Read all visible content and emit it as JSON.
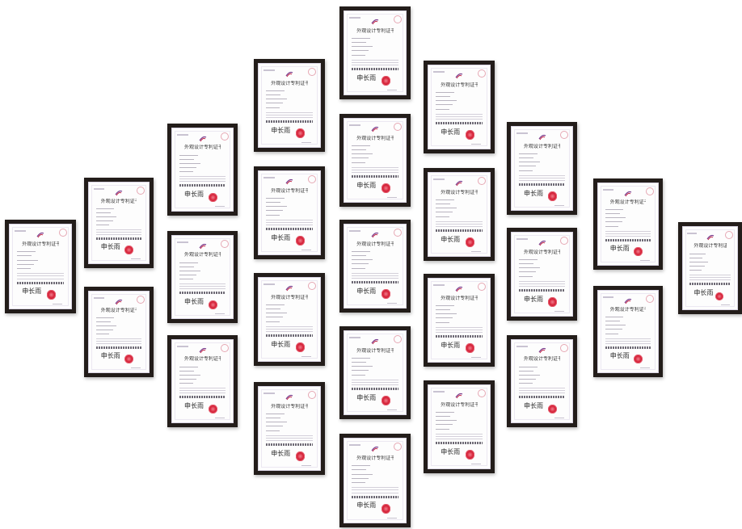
{
  "scene": {
    "description_free": true,
    "background_color": "#ffffff",
    "frame_color": "#231d1a",
    "seal_color": "#d8263c"
  },
  "certificate": {
    "title": "外观设计专利证书",
    "signature": "申长雨"
  },
  "certificates": [
    {
      "id": 1
    },
    {
      "id": 2
    },
    {
      "id": 3
    },
    {
      "id": 4
    },
    {
      "id": 5
    },
    {
      "id": 6
    },
    {
      "id": 7
    },
    {
      "id": 8
    },
    {
      "id": 9
    },
    {
      "id": 10
    },
    {
      "id": 11
    },
    {
      "id": 12
    },
    {
      "id": 13
    },
    {
      "id": 14
    },
    {
      "id": 15
    },
    {
      "id": 16
    },
    {
      "id": 17
    },
    {
      "id": 18
    },
    {
      "id": 19
    },
    {
      "id": 20
    },
    {
      "id": 21
    },
    {
      "id": 22
    },
    {
      "id": 23
    },
    {
      "id": 24
    },
    {
      "id": 25
    },
    {
      "id": 26
    }
  ]
}
